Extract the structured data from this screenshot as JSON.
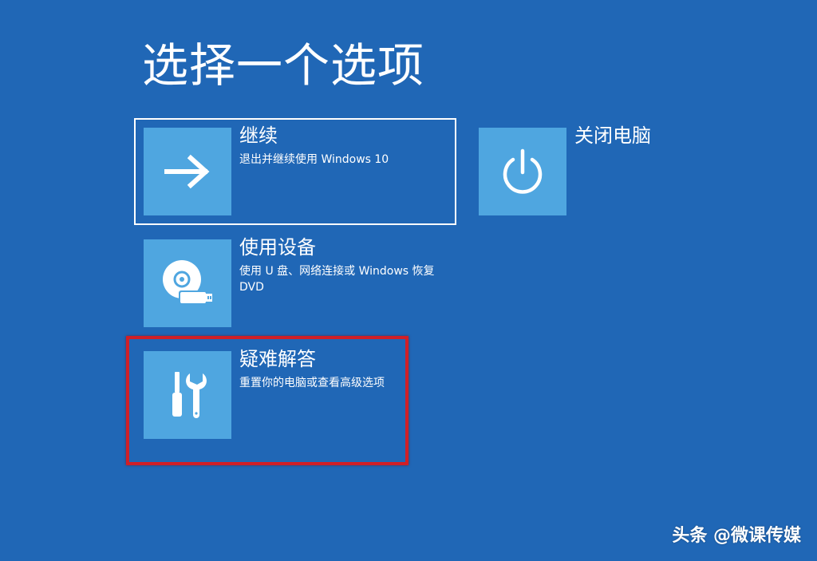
{
  "page_title": "选择一个选项",
  "options": {
    "continue": {
      "title": "继续",
      "description": "退出并继续使用 Windows 10",
      "icon": "arrow-right-icon"
    },
    "shutdown": {
      "title": "关闭电脑",
      "icon": "power-icon"
    },
    "use_device": {
      "title": "使用设备",
      "description": "使用 U 盘、网络连接或 Windows 恢复 DVD",
      "icon": "disc-usb-icon"
    },
    "troubleshoot": {
      "title": "疑难解答",
      "description": "重置你的电脑或查看高级选项",
      "icon": "tools-icon"
    }
  },
  "watermark": "头条 @微课传媒",
  "colors": {
    "background": "#2067b6",
    "tile": "#4fa6e0",
    "highlight_border": "#d11f27",
    "text": "#ffffff"
  }
}
